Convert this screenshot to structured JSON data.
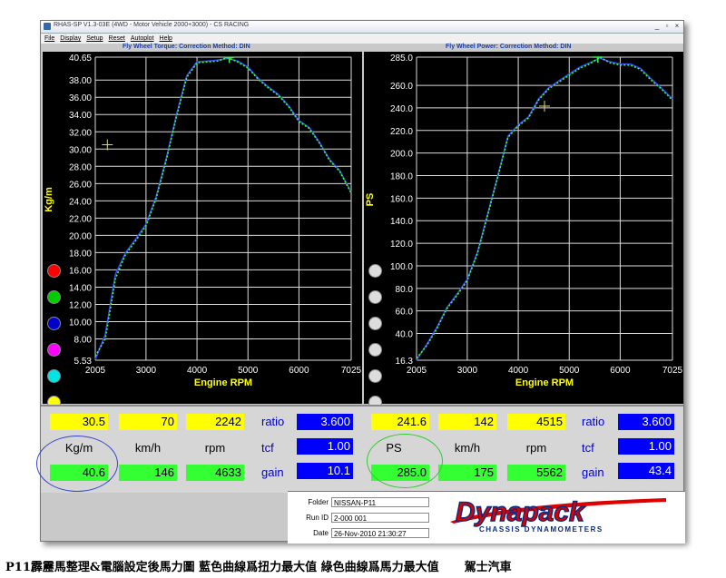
{
  "window": {
    "title": "RHAS-SP V1.3-03E  (4WD - Motor Vehicle 2000+3000) - CS RACING",
    "buttons": [
      "_",
      "▫",
      "×"
    ]
  },
  "menu": [
    "File",
    "Display",
    "Setup",
    "Reset",
    "Autoplot",
    "Help"
  ],
  "torque_header": "Fly Wheel Torque:      Correction Method: DIN",
  "power_header": "Fly Wheel Power:      Correction Method: DIN",
  "chart_data": [
    {
      "type": "line",
      "ylabel": "Kg/m",
      "xlabel": "Engine RPM",
      "xlim": [
        2005,
        7025
      ],
      "ylim": [
        5.53,
        40.65
      ],
      "x_ticks": [
        "2005",
        "3000",
        "4000",
        "5000",
        "6000",
        "7025"
      ],
      "y_ticks": [
        "40.65",
        "38.00",
        "36.00",
        "34.00",
        "32.00",
        "30.00",
        "28.00",
        "26.00",
        "24.00",
        "22.00",
        "20.00",
        "18.00",
        "16.00",
        "14.00",
        "12.00",
        "10.00",
        "8.00",
        "5.53"
      ],
      "grid": true,
      "cursor": {
        "x": 2242,
        "y": 30.5
      },
      "peak": {
        "x": 4633,
        "y": 40.6
      },
      "series": [
        {
          "color": "#3344ff",
          "x": [
            2005,
            2200,
            2400,
            2600,
            2800,
            3000,
            3200,
            3400,
            3600,
            3800,
            4000,
            4200,
            4400,
            4600,
            4800,
            5000,
            5200,
            5400,
            5600,
            5800,
            6000,
            6200,
            6400,
            6600,
            6800,
            7025
          ],
          "y": [
            5.6,
            8.5,
            15.5,
            18.0,
            19.6,
            21.3,
            24.5,
            29.0,
            34.0,
            38.5,
            40.1,
            40.2,
            40.3,
            40.5,
            40.2,
            39.5,
            38.2,
            37.2,
            36.3,
            35.0,
            33.3,
            32.5,
            30.8,
            28.8,
            27.5,
            25.0
          ]
        },
        {
          "color": "#33ff33",
          "x": [
            2005,
            2200,
            2400,
            2600,
            2800,
            3000,
            3200,
            3400,
            3600,
            3800,
            4000,
            4200,
            4400,
            4600,
            4800,
            5000,
            5200,
            5400,
            5600,
            5800,
            6000,
            6200,
            6400,
            6600,
            6800,
            7025
          ],
          "y": [
            6.0,
            8.0,
            15.0,
            17.8,
            19.4,
            21.1,
            24.3,
            28.8,
            33.8,
            38.3,
            40.0,
            40.1,
            40.2,
            40.6,
            40.1,
            39.4,
            38.1,
            37.1,
            36.2,
            34.9,
            33.2,
            32.4,
            30.7,
            28.7,
            27.4,
            24.9
          ]
        }
      ]
    },
    {
      "type": "line",
      "ylabel": "PS",
      "xlabel": "Engine RPM",
      "xlim": [
        2005,
        7025
      ],
      "ylim": [
        16.3,
        285.0
      ],
      "x_ticks": [
        "2005",
        "3000",
        "4000",
        "5000",
        "6000",
        "7025"
      ],
      "y_ticks": [
        "285.0",
        "260.0",
        "240.0",
        "220.0",
        "200.0",
        "180.0",
        "160.0",
        "140.0",
        "120.0",
        "100.0",
        "80.0",
        "60.0",
        "40.0",
        "16.3"
      ],
      "grid": true,
      "cursor": {
        "x": 4515,
        "y": 241.6
      },
      "peak": {
        "x": 5562,
        "y": 285.0
      },
      "series": [
        {
          "color": "#3344ff",
          "x": [
            2005,
            2200,
            2400,
            2600,
            2800,
            3000,
            3200,
            3400,
            3600,
            3800,
            4000,
            4200,
            4400,
            4600,
            4800,
            5000,
            5200,
            5400,
            5600,
            5800,
            6000,
            6200,
            6400,
            6600,
            6800,
            7025
          ],
          "y": [
            16.5,
            30,
            45,
            63,
            75,
            88,
            112,
            146,
            180,
            215,
            225,
            232,
            248,
            258,
            264,
            270,
            276,
            280,
            284,
            281,
            279,
            279,
            275,
            266,
            258,
            248
          ]
        },
        {
          "color": "#33ff33",
          "x": [
            2005,
            2200,
            2400,
            2600,
            2800,
            3000,
            3200,
            3400,
            3600,
            3800,
            4000,
            4200,
            4400,
            4600,
            4800,
            5000,
            5200,
            5400,
            5600,
            5800,
            6000,
            6200,
            6400,
            6600,
            6800,
            7025
          ],
          "y": [
            18,
            29,
            44,
            62,
            74,
            87,
            111,
            145,
            179,
            214,
            224,
            231,
            247,
            257,
            263,
            269,
            275,
            279,
            285,
            280,
            278,
            278,
            274,
            265,
            257,
            247
          ]
        }
      ]
    }
  ],
  "torque_swatches": [
    "#ff0000",
    "#00cc00",
    "#0000cc",
    "#ff00ff",
    "#00e5e5",
    "#ffff00"
  ],
  "power_swatches": [
    "#dddddd",
    "#dddddd",
    "#dddddd",
    "#dddddd",
    "#dddddd",
    "#dddddd"
  ],
  "torque_readout": {
    "cursor_value": "30.5",
    "cursor_speed": "70",
    "cursor_rpm": "2242",
    "ratio_label": "ratio",
    "ratio": "3.600",
    "unit_value": "Kg/m",
    "unit_speed": "km/h",
    "unit_rpm": "rpm",
    "tcf_label": "tcf",
    "tcf": "1.00",
    "peak_value": "40.6",
    "peak_speed": "146",
    "peak_rpm": "4633",
    "gain_label": "gain",
    "gain": "10.1"
  },
  "power_readout": {
    "cursor_value": "241.6",
    "cursor_speed": "142",
    "cursor_rpm": "4515",
    "ratio_label": "ratio",
    "ratio": "3.600",
    "unit_value": "PS",
    "unit_speed": "km/h",
    "unit_rpm": "rpm",
    "tcf_label": "tcf",
    "tcf": "1.00",
    "peak_value": "285.0",
    "peak_speed": "175",
    "peak_rpm": "5562",
    "gain_label": "gain",
    "gain": "43.4"
  },
  "info": {
    "folder_label": "Folder",
    "folder": "NISSAN-P11",
    "runid_label": "Run ID",
    "runid": "2-000   001",
    "date_label": "Date",
    "date": "26-Nov-2010  21:30:27"
  },
  "logo": {
    "name": "Dynapack",
    "tagline": "CHASSIS  DYNAMOMETERS"
  },
  "caption": "P11霹靂馬整理&電腦設定後馬力圖 藍色曲線爲扭力最大值 綠色曲線爲馬力最大值",
  "signature": "駕士汽車"
}
